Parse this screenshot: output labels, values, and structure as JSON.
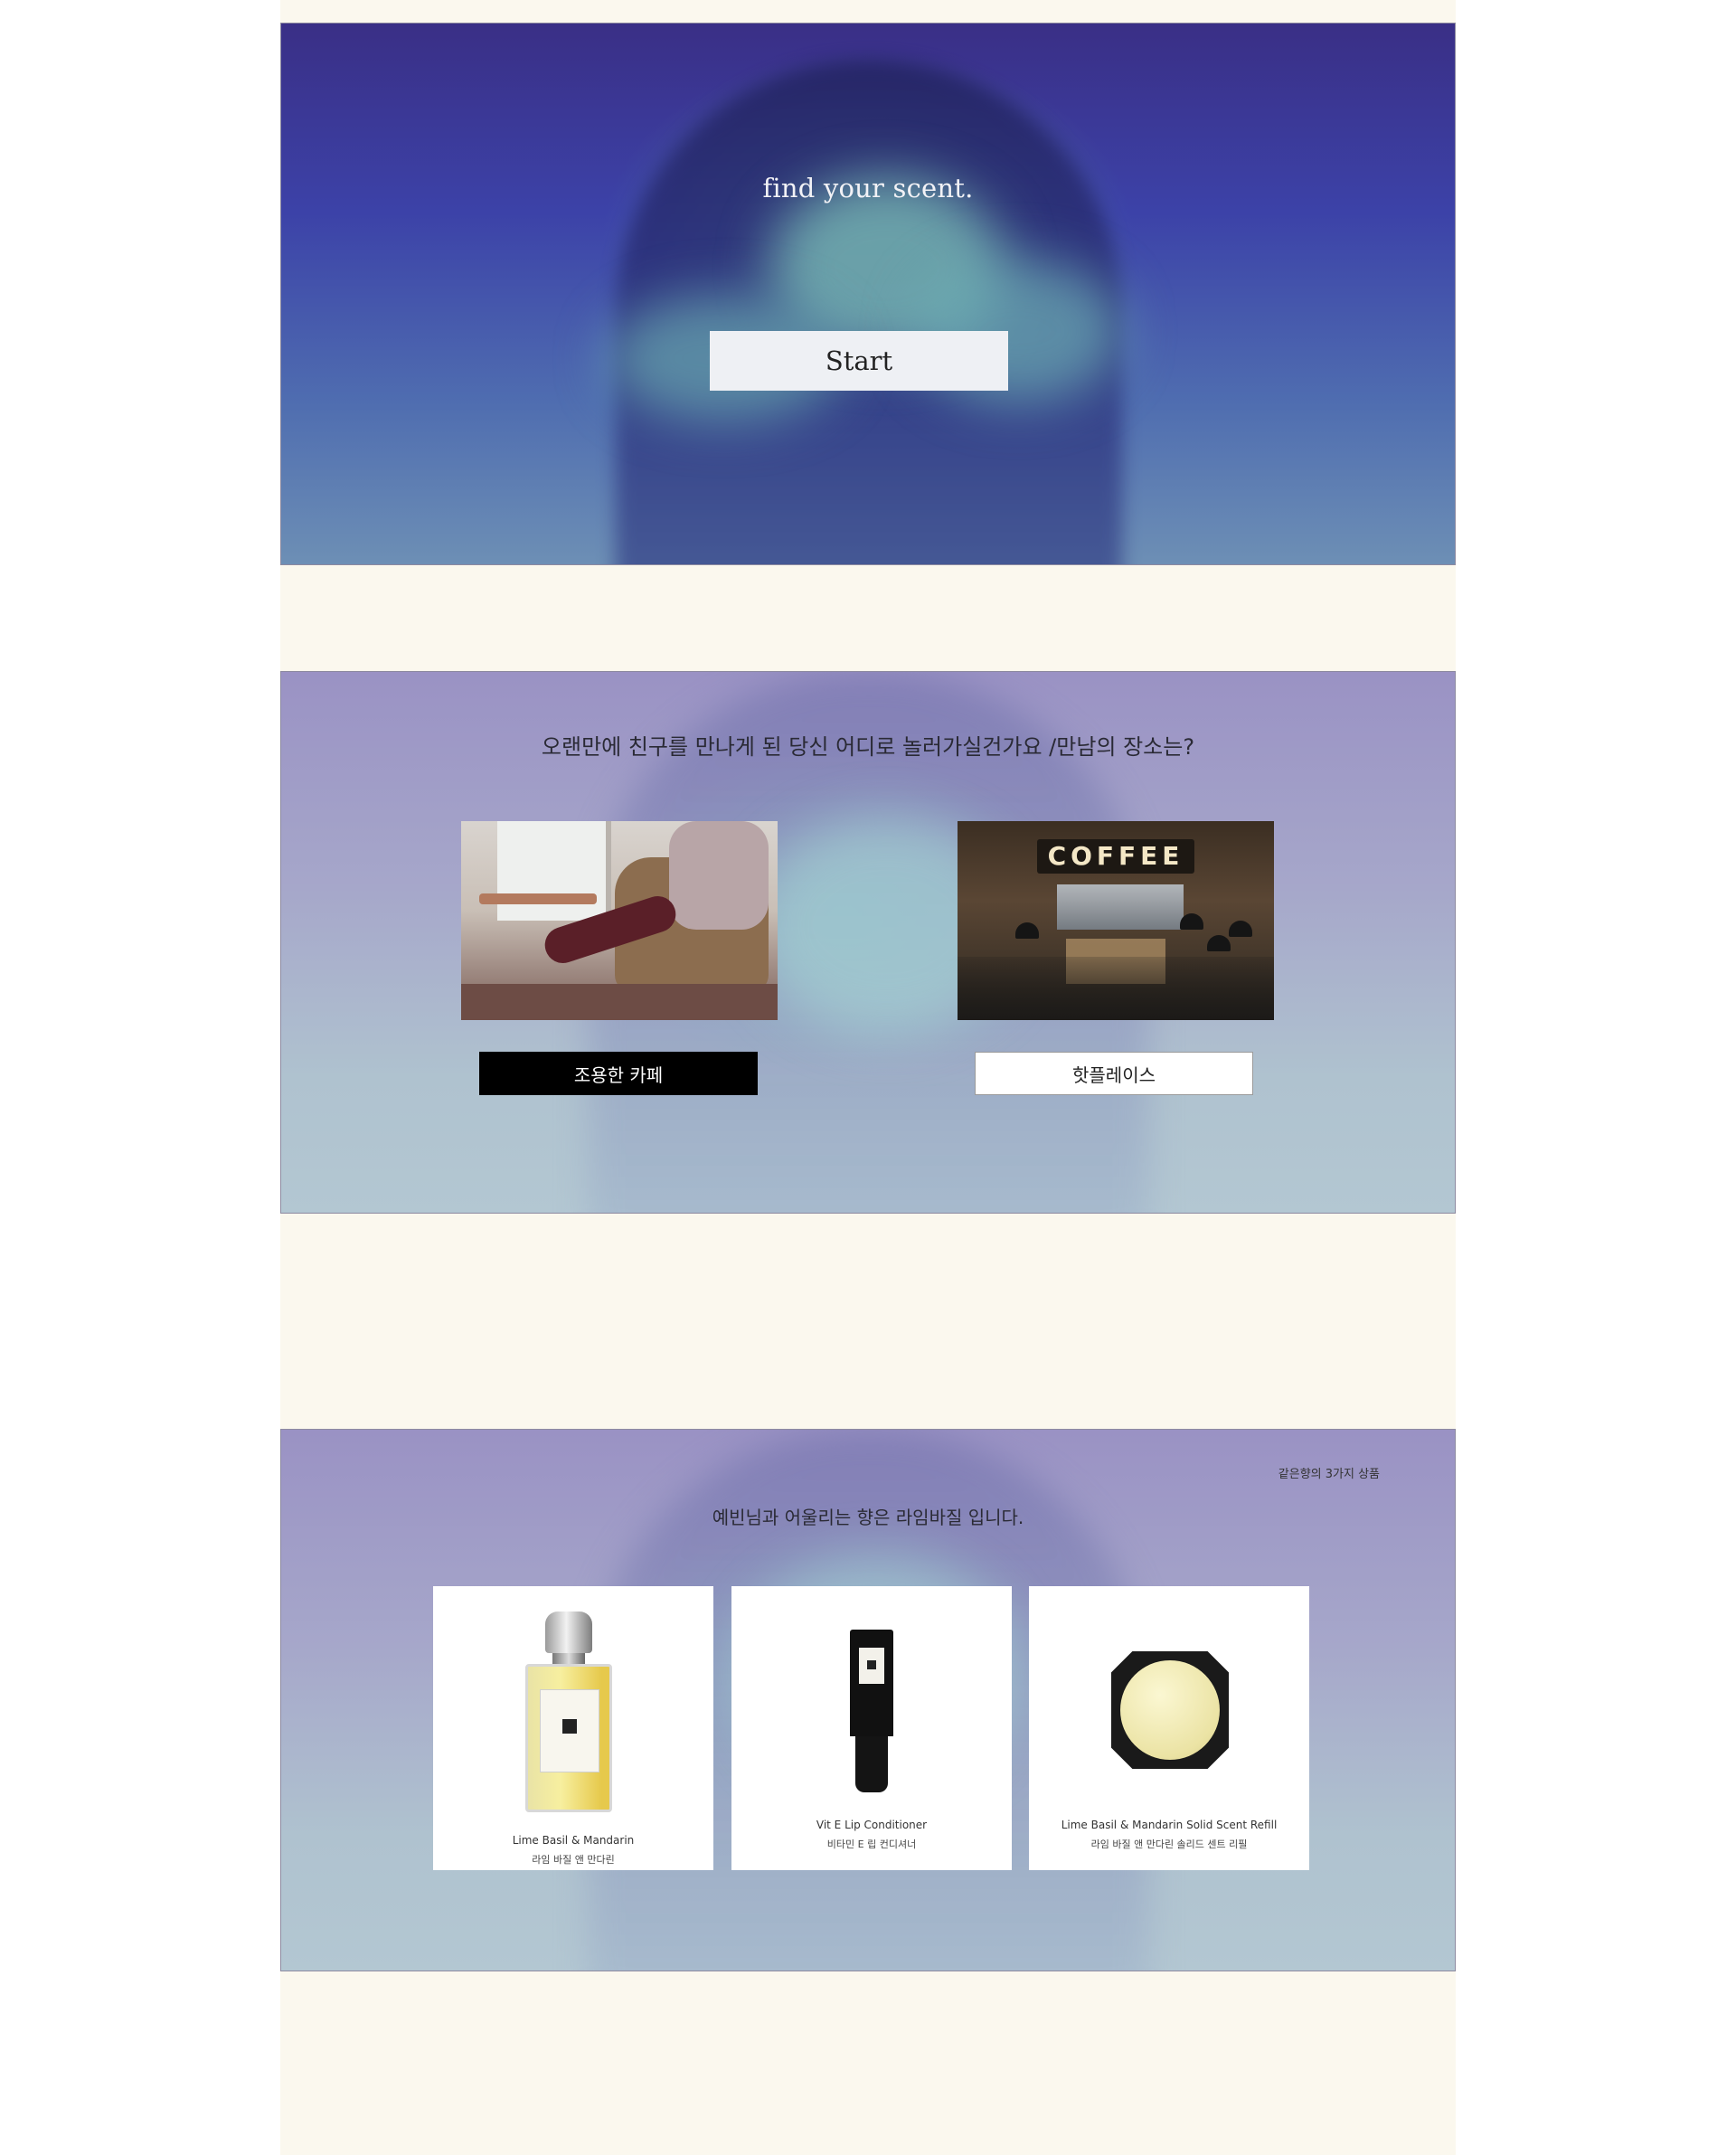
{
  "hero": {
    "title": "find your scent.",
    "start_label": "Start"
  },
  "question": {
    "text": "오랜만에 친구를 만나게 된 당신 어디로 놀러가실건가요 /만남의 장소는?",
    "left_choice": "조용한 카페",
    "right_choice": "핫플레이스",
    "coffee_sign": "COFFEE"
  },
  "result": {
    "top_right_link": "같은향의 3가지 상품",
    "text": "예빈님과 어울리는 향은 라임바질 입니다.",
    "products": [
      {
        "name": "Lime Basil & Mandarin",
        "sub": "라임 바질 앤 만다린"
      },
      {
        "name": "Vit E Lip Conditioner",
        "sub": "비타민 E 립 컨디셔너"
      },
      {
        "name": "Lime Basil & Mandarin Solid Scent Refill",
        "sub": "라임 바질 앤 만다린 솔리드 센트 리필"
      }
    ]
  }
}
